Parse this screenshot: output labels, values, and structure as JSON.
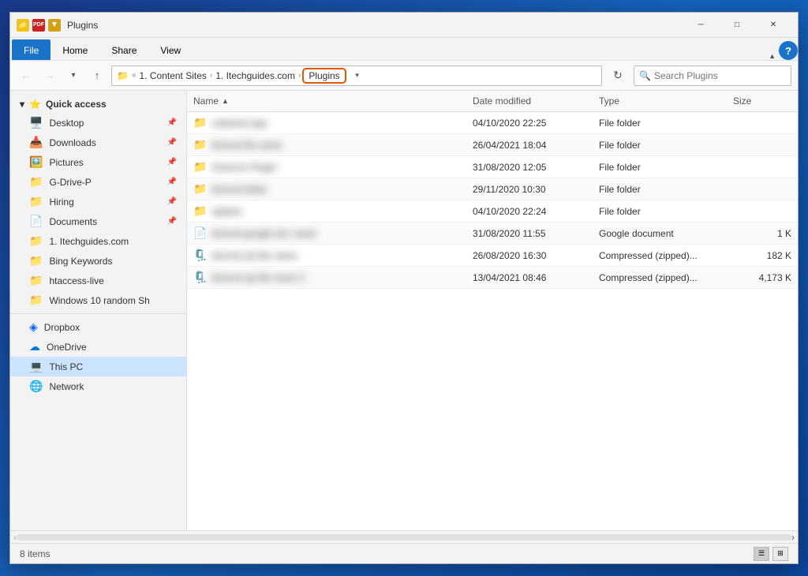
{
  "window": {
    "title": "Plugins"
  },
  "titlebar": {
    "icons": [
      "yellow-folder",
      "pdf",
      "gold"
    ],
    "title": "Plugins",
    "controls": [
      "minimize",
      "maximize",
      "close"
    ]
  },
  "ribbon": {
    "tabs": [
      "File",
      "Home",
      "Share",
      "View"
    ],
    "active_tab": "File",
    "expand_icon": "▼"
  },
  "addressbar": {
    "back_label": "←",
    "forward_label": "→",
    "dropdown_label": "▾",
    "up_label": "↑",
    "folder_icon": "📁",
    "path_segments": [
      "1. Content Sites",
      "1. Itechguides.com",
      "Plugins"
    ],
    "dropdown_btn": "▾",
    "refresh_label": "↻",
    "search_placeholder": "Search Plugins",
    "search_icon": "🔍"
  },
  "sidebar": {
    "sections": [
      {
        "id": "quick-access",
        "label": "Quick access",
        "icon": "⭐",
        "items": [
          {
            "id": "desktop",
            "label": "Desktop",
            "icon": "🖥️",
            "pinned": true
          },
          {
            "id": "downloads",
            "label": "Downloads",
            "icon": "📥",
            "pinned": true
          },
          {
            "id": "pictures",
            "label": "Pictures",
            "icon": "🖼️",
            "pinned": true
          },
          {
            "id": "gdrive-p",
            "label": "G-Drive-P",
            "icon": "📁",
            "pinned": true
          },
          {
            "id": "hiring",
            "label": "Hiring",
            "icon": "📁",
            "pinned": true
          },
          {
            "id": "documents",
            "label": "Documents",
            "icon": "📄",
            "pinned": true
          },
          {
            "id": "itechguides",
            "label": "1. Itechguides.com",
            "icon": "📁",
            "pinned": false
          },
          {
            "id": "bing-keywords",
            "label": "Bing Keywords",
            "icon": "📁",
            "pinned": false
          },
          {
            "id": "htaccess-live",
            "label": "htaccess-live",
            "icon": "📁",
            "pinned": false
          },
          {
            "id": "windows10-random",
            "label": "Windows 10 random Sh",
            "icon": "📁",
            "pinned": false
          }
        ]
      },
      {
        "id": "dropbox",
        "label": "Dropbox",
        "icon": "📦",
        "items": []
      },
      {
        "id": "onedrive",
        "label": "OneDrive",
        "icon": "☁️",
        "items": []
      },
      {
        "id": "this-pc",
        "label": "This PC",
        "icon": "💻",
        "items": [],
        "active": true
      },
      {
        "id": "network",
        "label": "Network",
        "icon": "🌐",
        "items": []
      }
    ]
  },
  "files": {
    "columns": [
      {
        "id": "name",
        "label": "Name"
      },
      {
        "id": "date",
        "label": "Date modified"
      },
      {
        "id": "type",
        "label": "Type"
      },
      {
        "id": "size",
        "label": "Size"
      }
    ],
    "rows": [
      {
        "id": 1,
        "name": "redacted app",
        "icon": "📁",
        "date": "04/10/2020 22:25",
        "type": "File folder",
        "size": "",
        "blurred": true
      },
      {
        "id": 2,
        "name": "blurred file name",
        "icon": "📁",
        "date": "26/04/2021 18:04",
        "type": "File folder",
        "size": "",
        "blurred": true
      },
      {
        "id": 3,
        "name": "Avancez Plugin",
        "icon": "📁",
        "date": "31/08/2020 12:05",
        "type": "File folder",
        "size": "",
        "blurred": true
      },
      {
        "id": 4,
        "name": "blurred folder",
        "icon": "📁",
        "date": "29/11/2020 10:30",
        "type": "File folder",
        "size": "",
        "blurred": true
      },
      {
        "id": 5,
        "name": "wpblurr",
        "icon": "📁",
        "date": "04/10/2020 22:24",
        "type": "File folder",
        "size": "",
        "blurred": true
      },
      {
        "id": 6,
        "name": "blurred google doc name",
        "icon": "📄",
        "date": "31/08/2020 11:55",
        "type": "Google document",
        "size": "1 K",
        "blurred": true
      },
      {
        "id": 7,
        "name": "blurred zip file name",
        "icon": "🗜️",
        "date": "26/08/2020 16:30",
        "type": "Compressed (zipped)...",
        "size": "182 K",
        "blurred": true
      },
      {
        "id": 8,
        "name": "blurred zip file name 2",
        "icon": "🗜️",
        "date": "13/04/2021 08:46",
        "type": "Compressed (zipped)...",
        "size": "4,173 K",
        "blurred": true
      }
    ]
  },
  "statusbar": {
    "item_count": "8 items",
    "view_icons": [
      "details",
      "large-icons"
    ]
  }
}
